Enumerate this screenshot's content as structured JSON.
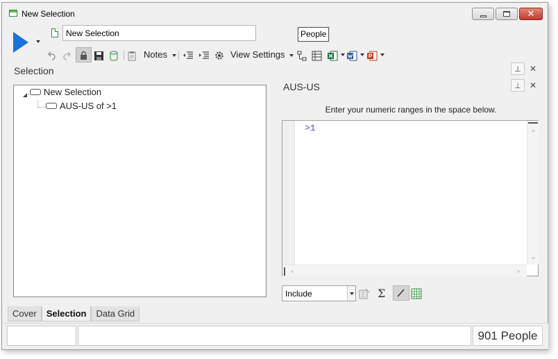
{
  "window": {
    "title": "New Selection"
  },
  "toolbar": {
    "selection_name": "New Selection",
    "people_label": "People",
    "notes_label": "Notes",
    "view_settings_label": "View Settings"
  },
  "left_panel": {
    "title": "Selection",
    "tree": {
      "root": "New Selection",
      "children": [
        "AUS-US of >1"
      ]
    }
  },
  "right_panel": {
    "title": "AUS-US",
    "instructions": "Enter your numeric ranges in the space below.",
    "editor_text": ">1",
    "mode": "Include"
  },
  "tabs": [
    {
      "label": "Cover",
      "active": false
    },
    {
      "label": "Selection",
      "active": true
    },
    {
      "label": "Data Grid",
      "active": false
    }
  ],
  "status": {
    "count": "901 People"
  },
  "colors": {
    "run_accent": "#1a73d9",
    "code_text": "#6d3fb5"
  }
}
